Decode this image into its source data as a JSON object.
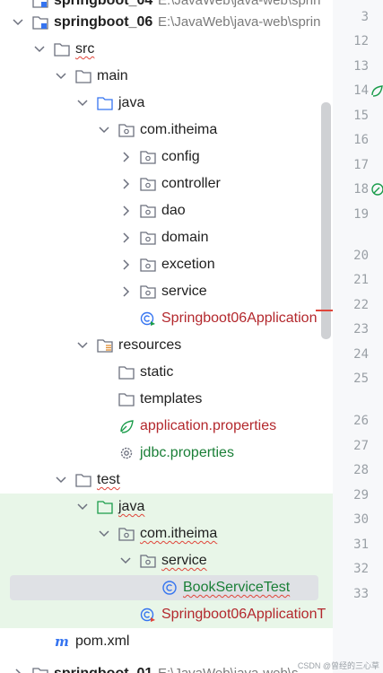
{
  "project": {
    "name": "springboot_06",
    "path": "E:\\JavaWeb\\java-web\\sprin"
  },
  "top_cut": {
    "name": "springboot_04",
    "path": "E:\\JavaWeb\\java-web\\sprin"
  },
  "tree": {
    "src": "src",
    "main": "main",
    "java": "java",
    "package": "com.itheima",
    "config": "config",
    "controller": "controller",
    "dao": "dao",
    "domain": "domain",
    "excetion": "excetion",
    "service": "service",
    "app_class": "Springboot06Application",
    "resources": "resources",
    "static": "static",
    "templates": "templates",
    "app_props": "application.properties",
    "jdbc_props": "jdbc.properties",
    "test": "test",
    "test_java": "java",
    "test_package": "com.itheima",
    "test_service": "service",
    "book_test": "BookServiceTest",
    "app_test": "Springboot06ApplicationT",
    "pom": "pom.xml",
    "bottom_cut_name": "springboot_01",
    "bottom_cut_path": "E:\\JavaWeb\\java-web\\s"
  },
  "line_numbers": [
    "3",
    "12",
    "13",
    "14",
    "15",
    "16",
    "17",
    "18",
    "19",
    "20",
    "21",
    "22",
    "23",
    "24",
    "25",
    "26",
    "27",
    "28",
    "29",
    "30",
    "31",
    "32",
    "33"
  ],
  "watermark": "CSDN @曾经的三心草"
}
